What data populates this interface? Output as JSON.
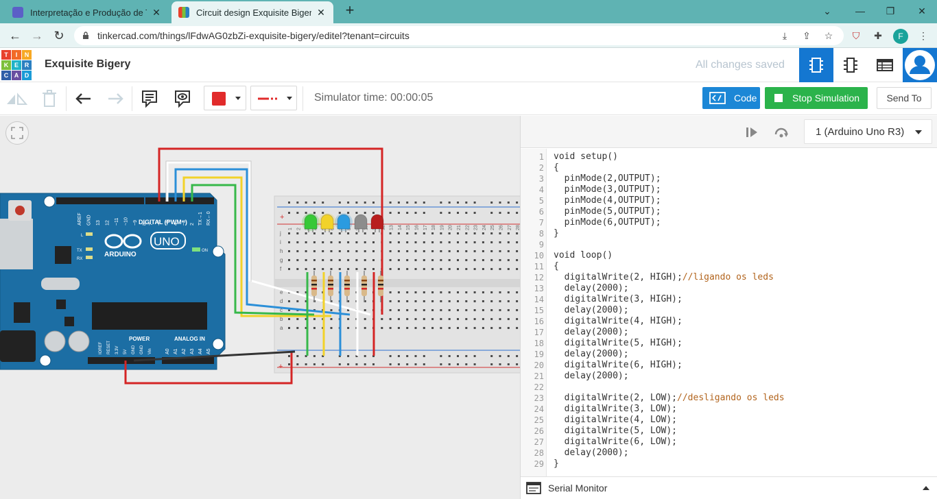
{
  "browser": {
    "tabs": [
      {
        "title": "Interpretação e Produção de Text",
        "close": "✕"
      },
      {
        "title": "Circuit design Exquisite Bigery | T",
        "close": "✕"
      }
    ],
    "new_tab": "+",
    "url": "tinkercad.com/things/lFdwAG0zbZi-exquisite-bigery/editel?tenant=circuits",
    "profile_initial": "F"
  },
  "header": {
    "logo_letters": [
      "T",
      "I",
      "N",
      "K",
      "E",
      "R",
      "C",
      "A",
      "D"
    ],
    "logo_colors": [
      "#e8412c",
      "#f26b27",
      "#f7a823",
      "#7cbf3a",
      "#1fb3c9",
      "#2a7fc1",
      "#2f5ea8",
      "#6a4ea1",
      "#1b9bd7"
    ],
    "project_title": "Exquisite Bigery",
    "save_status": "All changes saved"
  },
  "toolbar": {
    "simulator_time": "Simulator time: 00:00:05",
    "code_label": "Code",
    "stop_label": "Stop Simulation",
    "send_label": "Send To",
    "wire_color": "#e12b2b"
  },
  "code_panel": {
    "board": "1 (Arduino Uno R3)",
    "serial_monitor": "Serial Monitor",
    "lines": [
      {
        "n": "1",
        "code": "void setup()",
        "comment": ""
      },
      {
        "n": "2",
        "code": "{",
        "comment": ""
      },
      {
        "n": "3",
        "code": "  pinMode(2,OUTPUT);",
        "comment": ""
      },
      {
        "n": "4",
        "code": "  pinMode(3,OUTPUT);",
        "comment": ""
      },
      {
        "n": "5",
        "code": "  pinMode(4,OUTPUT);",
        "comment": ""
      },
      {
        "n": "6",
        "code": "  pinMode(5,OUTPUT);",
        "comment": ""
      },
      {
        "n": "7",
        "code": "  pinMode(6,OUTPUT);",
        "comment": ""
      },
      {
        "n": "8",
        "code": "}",
        "comment": ""
      },
      {
        "n": "9",
        "code": "",
        "comment": ""
      },
      {
        "n": "10",
        "code": "void loop()",
        "comment": ""
      },
      {
        "n": "11",
        "code": "{",
        "comment": ""
      },
      {
        "n": "12",
        "code": "  digitalWrite(2, HIGH);",
        "comment": "//ligando os leds"
      },
      {
        "n": "13",
        "code": "  delay(2000);",
        "comment": ""
      },
      {
        "n": "14",
        "code": "  digitalWrite(3, HIGH);",
        "comment": ""
      },
      {
        "n": "15",
        "code": "  delay(2000);",
        "comment": ""
      },
      {
        "n": "16",
        "code": "  digitalWrite(4, HIGH);",
        "comment": ""
      },
      {
        "n": "17",
        "code": "  delay(2000);",
        "comment": ""
      },
      {
        "n": "18",
        "code": "  digitalWrite(5, HIGH);",
        "comment": ""
      },
      {
        "n": "19",
        "code": "  delay(2000);",
        "comment": ""
      },
      {
        "n": "20",
        "code": "  digitalWrite(6, HIGH);",
        "comment": ""
      },
      {
        "n": "21",
        "code": "  delay(2000);",
        "comment": ""
      },
      {
        "n": "22",
        "code": "",
        "comment": ""
      },
      {
        "n": "23",
        "code": "  digitalWrite(2, LOW);",
        "comment": "//desligando os leds"
      },
      {
        "n": "24",
        "code": "  digitalWrite(3, LOW);",
        "comment": ""
      },
      {
        "n": "25",
        "code": "  digitalWrite(4, LOW);",
        "comment": ""
      },
      {
        "n": "26",
        "code": "  digitalWrite(5, LOW);",
        "comment": ""
      },
      {
        "n": "27",
        "code": "  digitalWrite(6, LOW);",
        "comment": ""
      },
      {
        "n": "28",
        "code": "  delay(2000);",
        "comment": ""
      },
      {
        "n": "29",
        "code": "}",
        "comment": ""
      }
    ]
  },
  "circuit": {
    "arduino": {
      "brand": "ARDUINO",
      "model": "UNO",
      "digital_label": "DIGITAL (PWM~)",
      "power_label": "POWER",
      "analog_label": "ANALOG IN",
      "on_label": "ON",
      "tx_label": "TX",
      "rx_label": "RX",
      "l_label": "L",
      "top_pins": [
        "AREF",
        "GND",
        "13",
        "12",
        "~11",
        "~10",
        "~9",
        "8",
        "7",
        "~6",
        "~5",
        "4",
        "~3",
        "2",
        "TX→1",
        "RX←0"
      ],
      "power_pins": [
        "IOREF",
        "RESET",
        "3.3V",
        "5V",
        "GND",
        "GND",
        "Vin"
      ],
      "analog_pins": [
        "A0",
        "A1",
        "A2",
        "A3",
        "A4",
        "A5"
      ]
    },
    "leds": [
      {
        "color": "#37c837",
        "lit": true
      },
      {
        "color": "#f2d22a",
        "lit": true
      },
      {
        "color": "#2b9be0",
        "lit": true
      },
      {
        "color": "#8d8d8d",
        "lit": false
      },
      {
        "color": "#b81e1e",
        "lit": false
      }
    ],
    "breadboard_rows": [
      "j",
      "i",
      "h",
      "g",
      "f",
      "e",
      "d",
      "c",
      "b",
      "a"
    ],
    "breadboard_cols": [
      "1",
      "2",
      "3",
      "4",
      "5",
      "6",
      "7",
      "8",
      "9",
      "10",
      "11",
      "12",
      "13",
      "14",
      "15",
      "16",
      "17",
      "18",
      "19",
      "20",
      "21",
      "22",
      "23",
      "24",
      "25",
      "26",
      "27",
      "28",
      "29",
      "30"
    ],
    "rail_plus": "+",
    "rail_minus": "−"
  }
}
